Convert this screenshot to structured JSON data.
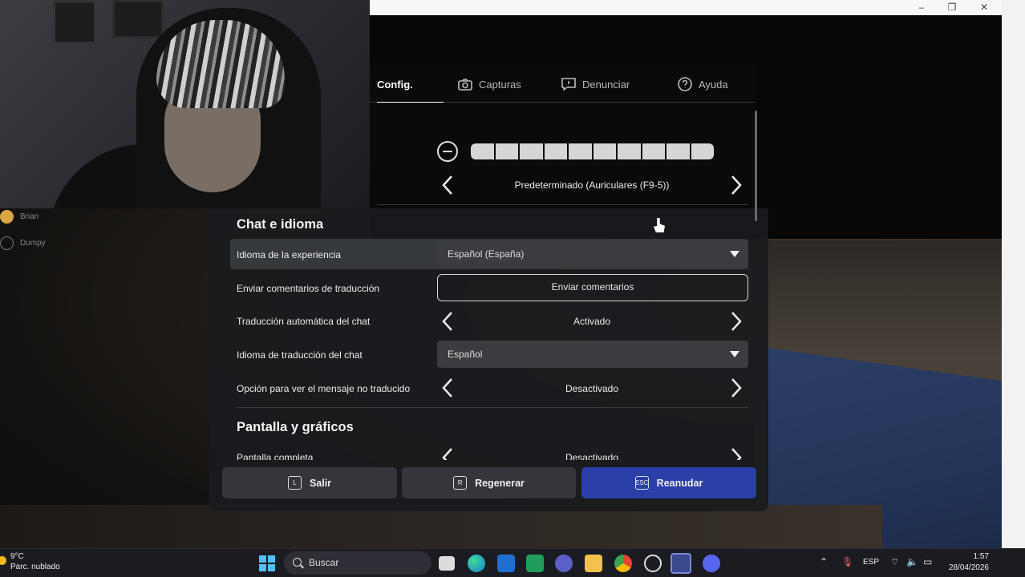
{
  "tabs": [
    {
      "label": "Config.",
      "icon": "settings-icon"
    },
    {
      "label": "Capturas",
      "icon": "camera-icon"
    },
    {
      "label": "Denunciar",
      "icon": "report-icon"
    },
    {
      "label": "Ayuda",
      "icon": "help-icon"
    }
  ],
  "players": [
    "Brian",
    "Dumpy"
  ],
  "audio": {
    "volume_level": 10,
    "volume_max": 10,
    "output_device": "Predeterminado (Auriculares (F9-5))"
  },
  "chat_section": {
    "title": "Chat e idioma",
    "experience_language_label": "Idioma de la experiencia",
    "experience_language_value": "Español (España)",
    "feedback_label": "Enviar comentarios de traducción",
    "feedback_button": "Enviar comentarios",
    "auto_translate_label": "Traducción automática del chat",
    "auto_translate_value": "Activado",
    "translate_language_label": "Idioma de traducción del chat",
    "translate_language_value": "Español",
    "untranslated_label": "Opción para ver el mensaje no traducido",
    "untranslated_value": "Desactivado"
  },
  "display_section": {
    "title": "Pantalla y gráficos",
    "fullscreen_label": "Pantalla completa",
    "fullscreen_value": "Desactivado"
  },
  "footer": {
    "leave": {
      "key": "L",
      "label": "Salir"
    },
    "reset": {
      "key": "R",
      "label": "Regenerar"
    },
    "resume": {
      "key": "ESC",
      "label": "Reanudar"
    }
  },
  "taskbar": {
    "weather_temp": "9°C",
    "weather_desc": "Parc. nublado",
    "search_placeholder": "Buscar",
    "language": "ESP",
    "time": "1:57",
    "date": "28/04/2026"
  },
  "colors": {
    "accent_resume": "#2b3fa8",
    "panel_bg": "#191b1e"
  }
}
